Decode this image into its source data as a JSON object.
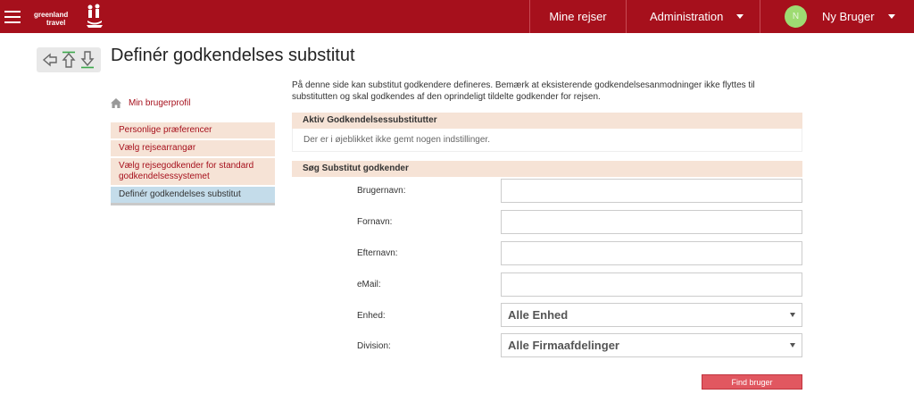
{
  "header": {
    "logo_line1": "greenland",
    "logo_line2": "travel",
    "nav_mine_rejser": "Mine rejser",
    "nav_administration": "Administration",
    "user_initial": "N",
    "user_name": "Ny Bruger",
    "brand_color": "#a6101c"
  },
  "page": {
    "title": "Definér godkendelses substitut",
    "intro": "På denne side kan substitut godkendere defineres. Bemærk at eksisterende godkendelsesanmodninger ikke flyttes til substitutten og skal godkendes af den oprindeligt tildelte godkender for rejsen."
  },
  "sidebar": {
    "profile_link": "Min brugerprofil",
    "items": [
      {
        "label": "Personlige præferencer"
      },
      {
        "label": "Vælg rejsearrangør"
      },
      {
        "label": "Vælg rejsegodkender for standard godkendelsessystemet"
      },
      {
        "label": "Definér godkendelses substitut"
      }
    ]
  },
  "active_section": {
    "heading": "Aktiv Godkendelsessubstitutter",
    "empty_text": "Der er i øjeblikket ikke gemt nogen indstillinger."
  },
  "search_section": {
    "heading": "Søg Substitut godkender",
    "fields": {
      "username_label": "Brugernavn:",
      "username_value": "",
      "firstname_label": "Fornavn:",
      "firstname_value": "",
      "lastname_label": "Efternavn:",
      "lastname_value": "",
      "email_label": "eMail:",
      "email_value": "",
      "unit_label": "Enhed:",
      "unit_value": "Alle Enhed",
      "division_label": "Division:",
      "division_value": "Alle Firmaafdelinger"
    },
    "find_button": "Find bruger"
  }
}
